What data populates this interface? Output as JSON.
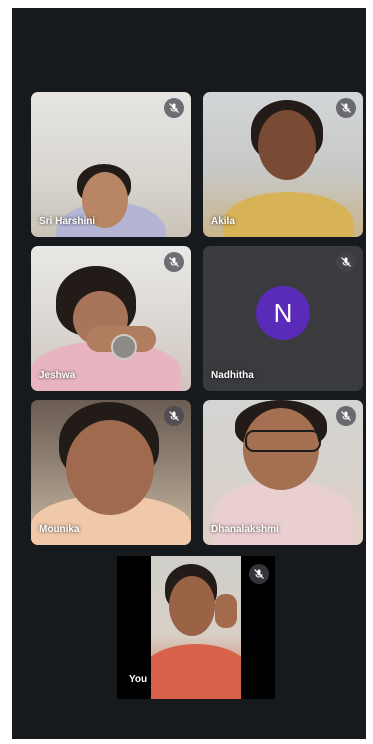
{
  "participants": [
    {
      "name": "Sri Harshini",
      "muted": true
    },
    {
      "name": "Akila",
      "muted": true
    },
    {
      "name": "Jeshwa",
      "muted": true
    },
    {
      "name": "Nadhitha",
      "muted": true,
      "avatar_letter": "N",
      "avatar_color": "#5a2ab8"
    },
    {
      "name": "Mounika",
      "muted": true
    },
    {
      "name": "Dhanalakshmi",
      "muted": true
    }
  ],
  "self": {
    "name": "You",
    "muted": true
  },
  "icons": {
    "mute": "mic-off-icon"
  },
  "colors": {
    "background": "#161a1d",
    "tile_empty": "#3a3b3e"
  }
}
